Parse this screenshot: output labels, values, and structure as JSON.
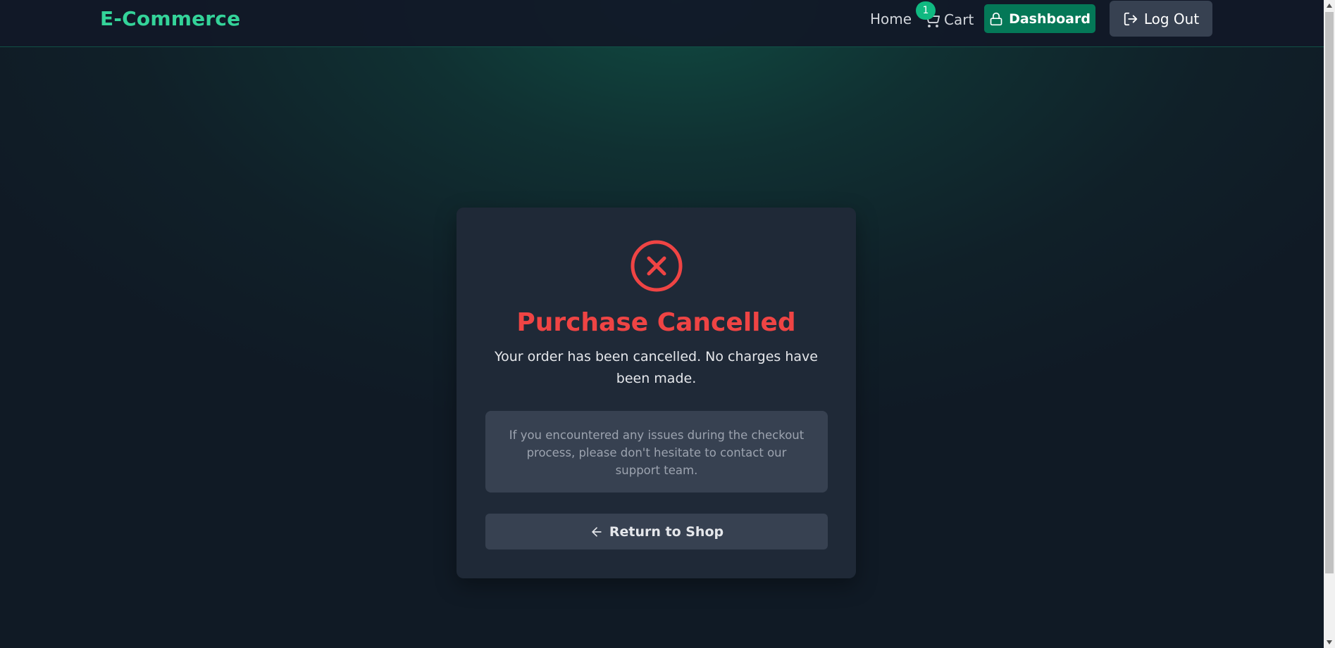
{
  "header": {
    "logo": "E-Commerce",
    "nav": {
      "home_label": "Home",
      "cart_label": "Cart",
      "cart_count": "1"
    },
    "dashboard_label": "Dashboard",
    "logout_label": "Log Out"
  },
  "card": {
    "title": "Purchase Cancelled",
    "message": "Your order has been cancelled. No charges have been made.",
    "info": "If you encountered any issues during the checkout process, please don't hesitate to contact our support team.",
    "return_label": "Return to Shop"
  },
  "icons": {
    "status": "x-circle-icon",
    "cart": "shopping-cart-icon",
    "dashboard": "lock-icon",
    "logout": "log-out-icon",
    "return": "arrow-left-icon"
  },
  "colors": {
    "brand": "#34d399",
    "badge": "#10b981",
    "dashboard_button": "#047857",
    "error": "#ef4444",
    "card_bg": "#1f2937",
    "secondary_bg": "#374151"
  }
}
